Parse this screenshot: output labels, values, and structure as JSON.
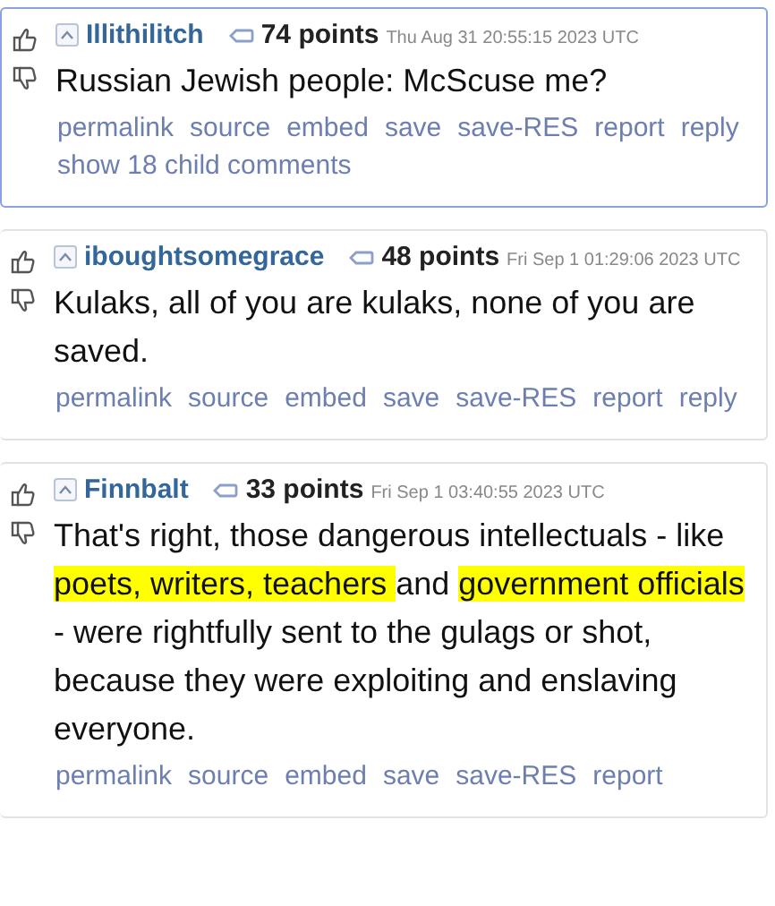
{
  "comments": [
    {
      "author": "Illithilitch",
      "points": "74 points",
      "timestamp": "Thu Aug 31 20:55:15 2023 UTC",
      "selected": true,
      "body": [
        {
          "text": "Russian Jewish people: McScuse me?",
          "highlighted": false
        }
      ],
      "links": [
        "permalink",
        "source",
        "embed",
        "save",
        "save-RES",
        "report",
        "reply",
        "show 18 child comments"
      ]
    },
    {
      "author": "iboughtsomegrace",
      "points": "48 points",
      "timestamp": "Fri Sep 1 01:29:06 2023 UTC",
      "selected": false,
      "body": [
        {
          "text": "Kulaks, all of you are kulaks, none of you are saved.",
          "highlighted": false
        }
      ],
      "links": [
        "permalink",
        "source",
        "embed",
        "save",
        "save-RES",
        "report",
        "reply"
      ]
    },
    {
      "author": "Finnbalt",
      "points": "33 points",
      "timestamp": "Fri Sep 1 03:40:55 2023 UTC",
      "selected": false,
      "body": [
        {
          "text": "That's right, those dangerous intellectuals - like ",
          "highlighted": false
        },
        {
          "text": "poets, writers, teachers ",
          "highlighted": true
        },
        {
          "text": "and ",
          "highlighted": false
        },
        {
          "text": "government officials",
          "highlighted": true
        },
        {
          "text": " - were rightfully sent to the gulags or shot, because they were exploiting and enslaving everyone.",
          "highlighted": false
        }
      ],
      "links": [
        "permalink",
        "source",
        "embed",
        "save",
        "save-RES",
        "report"
      ]
    }
  ]
}
